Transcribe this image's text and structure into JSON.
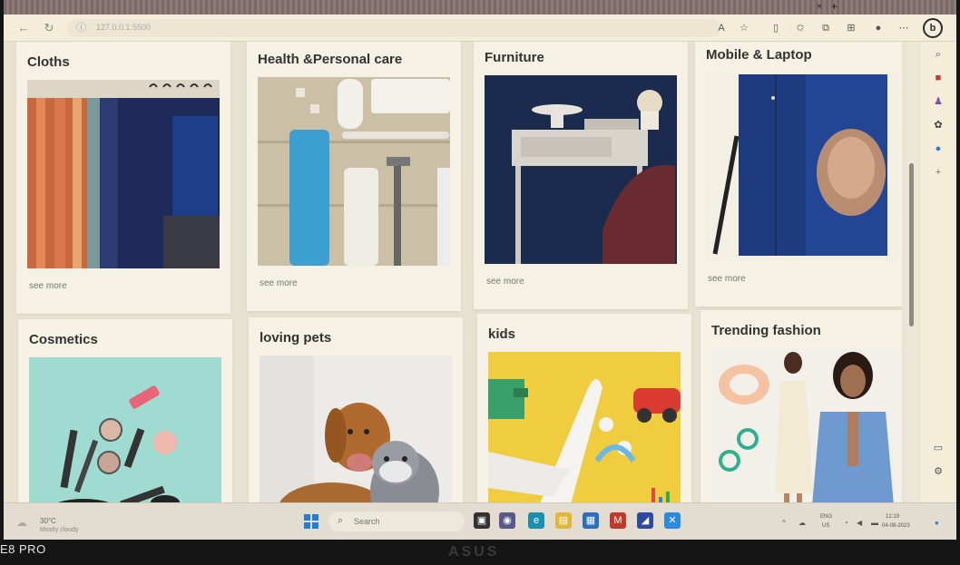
{
  "browser": {
    "address": "127.0.0.1:5500",
    "tab_close_glyph": "×",
    "tab_new_glyph": "+",
    "icons": [
      "back-icon",
      "refresh-icon",
      "info-icon",
      "read-aloud-icon",
      "favorite-star-icon",
      "split-screen-icon",
      "favorites-icon",
      "collections-icon",
      "extensions-icon",
      "profile-icon",
      "more-icon",
      "bing-icon"
    ],
    "bing_label": "b"
  },
  "cards": [
    {
      "title": "Cloths",
      "see_more": "see more"
    },
    {
      "title": "Health &Personal care",
      "see_more": "see more"
    },
    {
      "title": "Furniture",
      "see_more": "see more"
    },
    {
      "title": "Mobile & Laptop",
      "see_more": "see more"
    },
    {
      "title": "Cosmetics",
      "see_more": ""
    },
    {
      "title": "loving pets",
      "see_more": ""
    },
    {
      "title": "kids",
      "see_more": ""
    },
    {
      "title": "Trending fashion",
      "see_more": ""
    }
  ],
  "taskbar": {
    "weather_temp": "30°C",
    "weather_desc": "Mostly cloudy",
    "search_label": "Search",
    "tray_lang": "ENG",
    "tray_region": "US",
    "tray_time": "12:19",
    "tray_date": "04-08-2023"
  },
  "device": {
    "phone_watermark": "E8 PRO",
    "laptop_logo": "ASUS"
  }
}
